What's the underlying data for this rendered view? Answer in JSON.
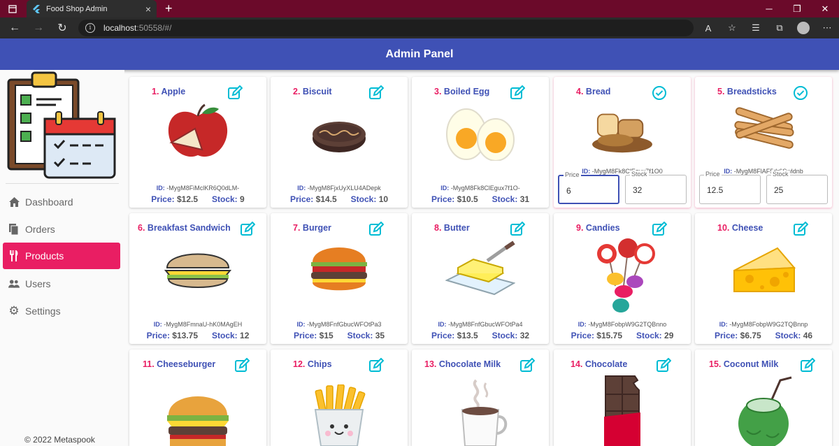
{
  "browser": {
    "tab_title": "Food Shop Admin",
    "url_host": "localhost",
    "url_rest": ":50558/#/"
  },
  "header": {
    "title": "Admin Panel"
  },
  "sidebar": {
    "items": [
      {
        "label": "Dashboard",
        "icon": "home-icon"
      },
      {
        "label": "Orders",
        "icon": "orders-icon"
      },
      {
        "label": "Products",
        "icon": "fork-knife-icon",
        "active": true
      },
      {
        "label": "Users",
        "icon": "users-icon"
      },
      {
        "label": "Settings",
        "icon": "gear-icon"
      }
    ],
    "footer": "© 2022 Metaspook"
  },
  "products": [
    {
      "num": "1.",
      "name": "Apple",
      "id": "-MygM8FiMclKR6Q0dLM-",
      "price": "$12.5",
      "stock": "9"
    },
    {
      "num": "2.",
      "name": "Biscuit",
      "id": "-MygM8FjxUyXLU4ADepk",
      "price": "$14.5",
      "stock": "10"
    },
    {
      "num": "3.",
      "name": "Boiled Egg",
      "id": "-MygM8Fk8ClEgux7f1O-",
      "price": "$10.5",
      "stock": "31"
    },
    {
      "num": "4.",
      "name": "Bread",
      "id": "-MygM8Fk8ClEgux7f1O0",
      "price_label": "Price",
      "price_input": "6",
      "stock_label": "Stock",
      "stock_input": "32"
    },
    {
      "num": "5.",
      "name": "Breadsticks",
      "id": "-MygM8FlAF5dr6Swldnb",
      "price_label": "Price",
      "price_input": "12.5",
      "stock_label": "Stock",
      "stock_input": "25"
    },
    {
      "num": "6.",
      "name": "Breakfast Sandwich",
      "id": "-MygM8FmnaU-hK0MAgEH",
      "price": "$13.75",
      "stock": "12"
    },
    {
      "num": "7.",
      "name": "Burger",
      "id": "-MygM8FnfGbucWFOtPa3",
      "price": "$15",
      "stock": "35"
    },
    {
      "num": "8.",
      "name": "Butter",
      "id": "-MygM8FnfGbucWFOtPa4",
      "price": "$13.5",
      "stock": "32"
    },
    {
      "num": "9.",
      "name": "Candies",
      "id": "-MygM8FobpW9G2TQBnno",
      "price": "$15.75",
      "stock": "29"
    },
    {
      "num": "10.",
      "name": "Cheese",
      "id": "-MygM8FobpW9G2TQBnnp",
      "price": "$6.75",
      "stock": "46"
    },
    {
      "num": "11.",
      "name": "Cheeseburger"
    },
    {
      "num": "12.",
      "name": "Chips"
    },
    {
      "num": "13.",
      "name": "Chocolate Milk"
    },
    {
      "num": "14.",
      "name": "Chocolate"
    },
    {
      "num": "15.",
      "name": "Coconut Milk"
    }
  ],
  "labels": {
    "id": "ID:",
    "price": "Price:",
    "stock": "Stock:"
  },
  "colors": {
    "primary": "#3f51b5",
    "accent": "#e91e63",
    "edit_icon": "#00bcd4"
  }
}
